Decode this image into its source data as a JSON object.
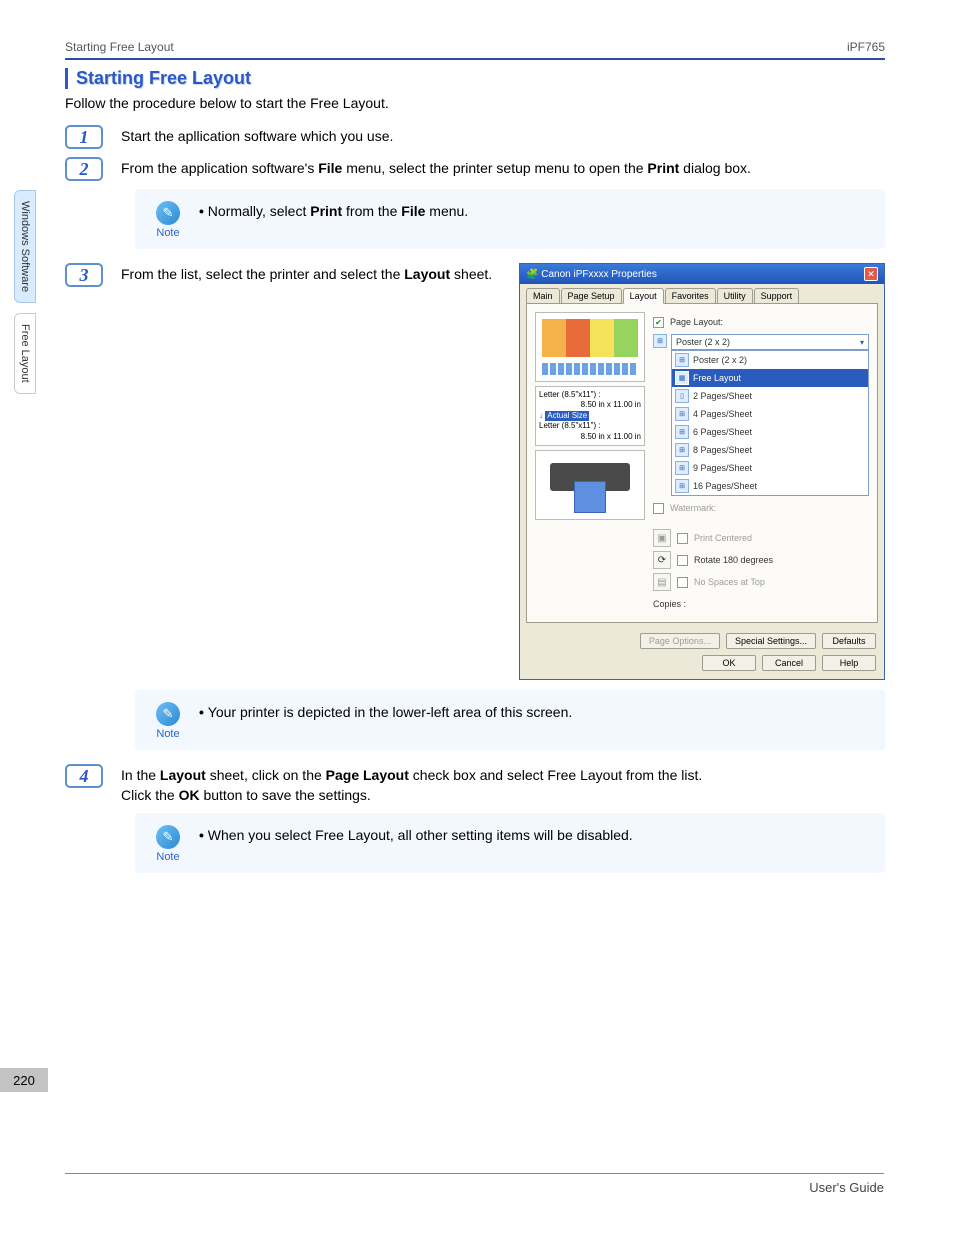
{
  "header": {
    "left": "Starting Free Layout",
    "right": "iPF765"
  },
  "section_title": "Starting Free Layout",
  "intro": "Follow the procedure below to start the Free Layout.",
  "side_tabs": {
    "a": "Windows Software",
    "b": "Free Layout"
  },
  "steps": {
    "s1": {
      "num": "1",
      "text": "Start the apllication software which you use."
    },
    "s2": {
      "num": "2",
      "text_pre": "From the application software's ",
      "file": "File",
      "text_mid": " menu, select the printer setup menu to open the ",
      "print": "Print",
      "text_post": " dialog box."
    },
    "s3": {
      "num": "3",
      "text_pre": "From the list, select the printer and select the ",
      "layout": "Layout",
      "text_post": " sheet."
    },
    "s4": {
      "num": "4",
      "line1_pre": "In the ",
      "layout": "Layout",
      "line1_mid": " sheet, click on the ",
      "pagelayout": "Page Layout",
      "line1_post": " check box and select Free Layout from the list.",
      "line2_pre": "Click the ",
      "ok": "OK",
      "line2_post": " button to save the settings."
    }
  },
  "notes": {
    "label": "Note",
    "n1_pre": "Normally, select ",
    "n1_print": "Print",
    "n1_mid": " from the ",
    "n1_file": "File",
    "n1_post": " menu.",
    "n2": "Your printer is depicted in the lower-left area of this screen.",
    "n3": "When you select Free Layout, all other setting items will be disabled."
  },
  "dialog": {
    "title": "Canon iPFxxxx Properties",
    "tabs": [
      "Main",
      "Page Setup",
      "Layout",
      "Favorites",
      "Utility",
      "Support"
    ],
    "active_tab": 2,
    "preview": {
      "line1a": "Letter (8.5\"x11\") :",
      "line1b": "8.50 in x 11.00 in",
      "actual": "Actual Size",
      "line2a": "Letter (8.5\"x11\") :",
      "line2b": "8.50 in x 11.00 in"
    },
    "controls": {
      "page_layout": "Page Layout:",
      "watermark": "Watermark:",
      "print_centered": "Print Centered",
      "rotate": "Rotate 180 degrees",
      "no_spaces": "No Spaces at Top",
      "copies": "Copies :"
    },
    "dropdown": {
      "selected": "Poster (2 x 2)",
      "items": [
        "Poster (2 x 2)",
        "Free Layout",
        "2 Pages/Sheet",
        "4 Pages/Sheet",
        "6 Pages/Sheet",
        "8 Pages/Sheet",
        "9 Pages/Sheet",
        "16 Pages/Sheet"
      ],
      "selected_index": 1
    },
    "buttons": {
      "page_options": "Page Options...",
      "special": "Special Settings...",
      "defaults": "Defaults",
      "ok": "OK",
      "cancel": "Cancel",
      "help": "Help"
    }
  },
  "page_number": "220",
  "footer": "User's Guide",
  "chart_data": null
}
